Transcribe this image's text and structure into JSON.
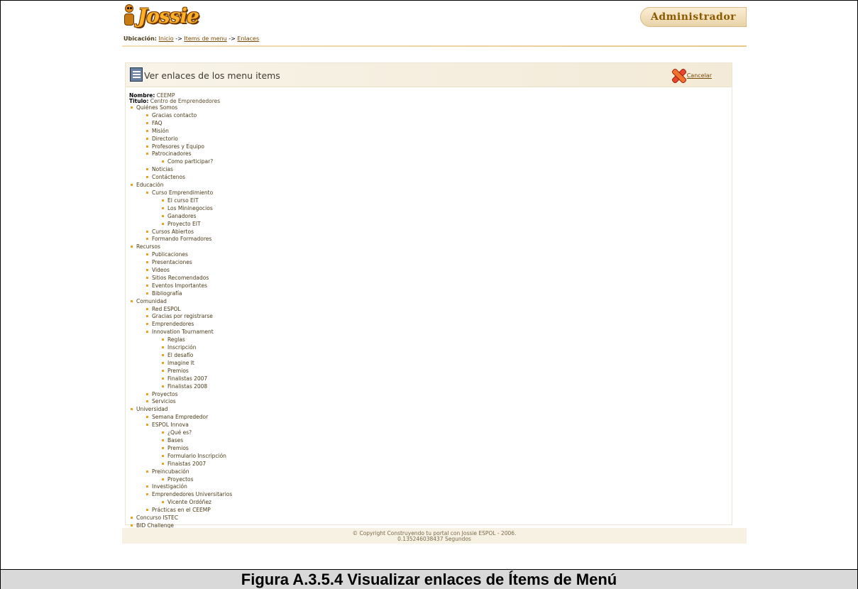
{
  "header": {
    "logo_text": "Jossie",
    "admin_label": "Administrador"
  },
  "breadcrumb": {
    "label": "Ubicación:",
    "links": [
      "Inicio",
      "Items de menu",
      "Enlaces"
    ],
    "separator": "->"
  },
  "panel": {
    "title": "Ver enlaces de los menu items",
    "cancel_label": "Cancelar",
    "nombre_label": "Nombre:",
    "nombre_value": "CEEMP",
    "titulo_label": "Titulo:",
    "titulo_value": "Centro de Emprendedores"
  },
  "tree": [
    {
      "label": "Quiénes Somos",
      "children": [
        {
          "label": "Gracias contacto"
        },
        {
          "label": "FAQ"
        },
        {
          "label": "Misión"
        },
        {
          "label": "Directorio"
        },
        {
          "label": "Profesores y Equipo"
        },
        {
          "label": "Patrocinadores",
          "children": [
            {
              "label": "Como participar?"
            }
          ]
        },
        {
          "label": "Noticias"
        },
        {
          "label": "Contáctenos"
        }
      ]
    },
    {
      "label": "Educación",
      "children": [
        {
          "label": "Curso Emprendimiento",
          "children": [
            {
              "label": "El curso EIT"
            },
            {
              "label": "Los Mininegocios"
            },
            {
              "label": "Ganadores"
            },
            {
              "label": "Proyecto EIT"
            }
          ]
        },
        {
          "label": "Cursos Abiertos"
        },
        {
          "label": "Formando Formadores"
        }
      ]
    },
    {
      "label": "Recursos",
      "children": [
        {
          "label": "Publicaciones"
        },
        {
          "label": "Presentaciones"
        },
        {
          "label": "Videos"
        },
        {
          "label": "Sitios Recomendados"
        },
        {
          "label": "Eventos Importantes"
        },
        {
          "label": "Bibliografía"
        }
      ]
    },
    {
      "label": "Comunidad",
      "children": [
        {
          "label": "Red ESPOL"
        },
        {
          "label": "Gracias por registrarse"
        },
        {
          "label": "Emprendedores"
        },
        {
          "label": "Innovation Tournament",
          "children": [
            {
              "label": "Reglas"
            },
            {
              "label": "Inscripción"
            },
            {
              "label": "El desafío"
            },
            {
              "label": "Imagine It"
            },
            {
              "label": "Premios"
            },
            {
              "label": "Finalistas 2007"
            },
            {
              "label": "Finalistas 2008"
            }
          ]
        },
        {
          "label": "Proyectos"
        },
        {
          "label": "Servicios"
        }
      ]
    },
    {
      "label": "Universidad",
      "children": [
        {
          "label": "Semana Emprededor"
        },
        {
          "label": "ESPOL Innova",
          "children": [
            {
              "label": "¿Qué es?"
            },
            {
              "label": "Bases"
            },
            {
              "label": "Premios"
            },
            {
              "label": "Formulario Inscripción"
            },
            {
              "label": "Finaistas 2007"
            }
          ]
        },
        {
          "label": "Preincubación",
          "children": [
            {
              "label": "Proyectos"
            }
          ]
        },
        {
          "label": "Investigación"
        },
        {
          "label": "Emprendedores Universitarios",
          "children": [
            {
              "label": "Vicente Ordóñez"
            }
          ]
        },
        {
          "label": "Prácticas en el CEEMP"
        }
      ]
    },
    {
      "label": "Concurso ISTEC"
    },
    {
      "label": "BID Challenge"
    }
  ],
  "footer": {
    "line1": "© Copyright Construyendo tu portal con Jossie ESPOL - 2006.",
    "line2": "0.135246038437 Segundos"
  },
  "caption": "Figura A.3.5.4 Visualizar enlaces de Ítems de Menú",
  "colors": {
    "accent": "#e9a31e",
    "link": "#7a4a00"
  }
}
